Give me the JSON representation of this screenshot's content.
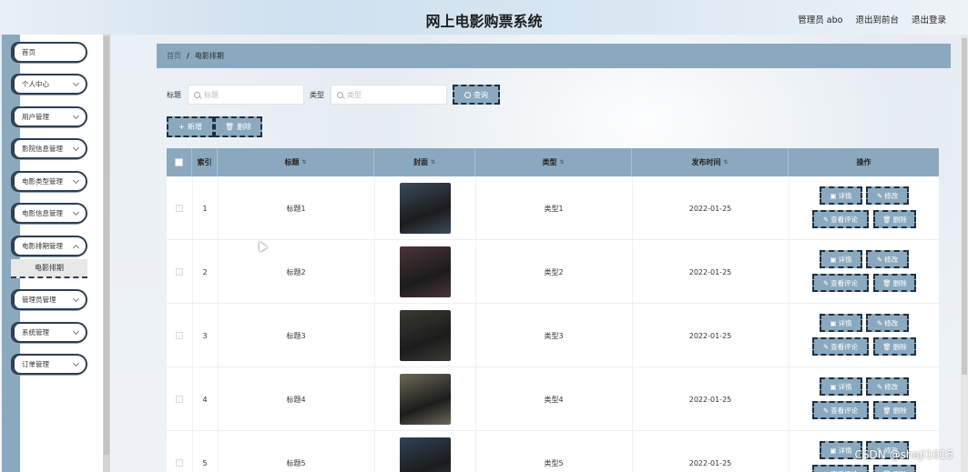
{
  "header": {
    "title": "网上电影购票系统",
    "admin_label": "管理员 abo",
    "back_front": "退出到前台",
    "logout": "退出登录"
  },
  "sidebar": {
    "items": [
      {
        "label": "首页"
      },
      {
        "label": "个人中心"
      },
      {
        "label": "用户管理"
      },
      {
        "label": "影院信息管理"
      },
      {
        "label": "电影类型管理"
      },
      {
        "label": "电影信息管理"
      },
      {
        "label": "电影排期管理"
      },
      {
        "label": "管理员管理"
      },
      {
        "label": "系统管理"
      },
      {
        "label": "订单管理"
      }
    ],
    "active_sub": "电影排期"
  },
  "breadcrumb": {
    "home": "首页",
    "separator": "/",
    "current": "电影排期"
  },
  "search": {
    "title_label": "标题",
    "title_placeholder": "标题",
    "type_label": "类型",
    "type_placeholder": "类型",
    "query_button": "查询"
  },
  "actions": {
    "add": "新增",
    "delete": "删除"
  },
  "table": {
    "headers": {
      "index": "索引",
      "title": "标题",
      "cover": "封面",
      "type": "类型",
      "publish_time": "发布时间",
      "ops": "操作"
    },
    "op_labels": {
      "detail": "详情",
      "edit": "修改",
      "comments": "查看评论",
      "delete": "删除"
    },
    "rows": [
      {
        "index": "1",
        "title": "标题1",
        "type": "类型1",
        "date": "2022-01-25",
        "cover_color": "#3b4a5c"
      },
      {
        "index": "2",
        "title": "标题2",
        "type": "类型2",
        "date": "2022-01-25",
        "cover_color": "#4b3438"
      },
      {
        "index": "3",
        "title": "标题3",
        "type": "类型3",
        "date": "2022-01-25",
        "cover_color": "#3a3a32"
      },
      {
        "index": "4",
        "title": "标题4",
        "type": "类型4",
        "date": "2022-01-25",
        "cover_color": "#6b6a58"
      },
      {
        "index": "5",
        "title": "标题5",
        "type": "类型5",
        "date": "2022-01-25",
        "cover_color": "#2f4256"
      }
    ]
  },
  "colors": {
    "accent": "#8aa9bf",
    "dark_border": "#1f2f3d"
  },
  "watermark": "CSDN @shaji1015"
}
